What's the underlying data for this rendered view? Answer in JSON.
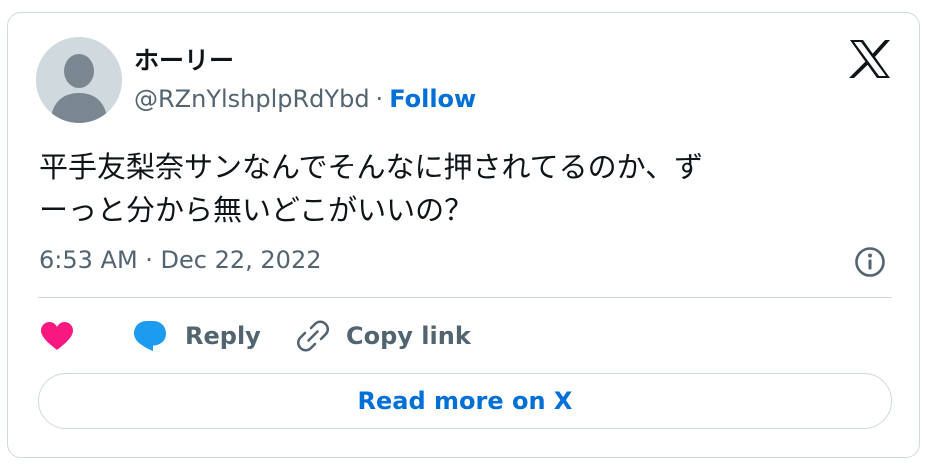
{
  "author": {
    "display_name": "ホーリー",
    "handle": "@RZnYlshplpRdYbd",
    "separator": "·",
    "follow_label": "Follow"
  },
  "tweet": {
    "text_line1": "平手友梨奈サンなんでそんなに押されてるのか、ず",
    "text_line2": "ーっと分から無いどこがいいの？",
    "timestamp": "6:53 AM · Dec 22, 2022"
  },
  "actions": {
    "like_icon": "heart-icon",
    "reply_label": "Reply",
    "reply_icon": "speech-bubble-icon",
    "copy_label": "Copy link",
    "copy_icon": "link-icon"
  },
  "read_more_label": "Read more on X",
  "colors": {
    "accent": "#006fd6",
    "like": "#f91880",
    "reply_icon": "#1d9bf0",
    "muted": "#536471",
    "border": "#cfd9de"
  }
}
